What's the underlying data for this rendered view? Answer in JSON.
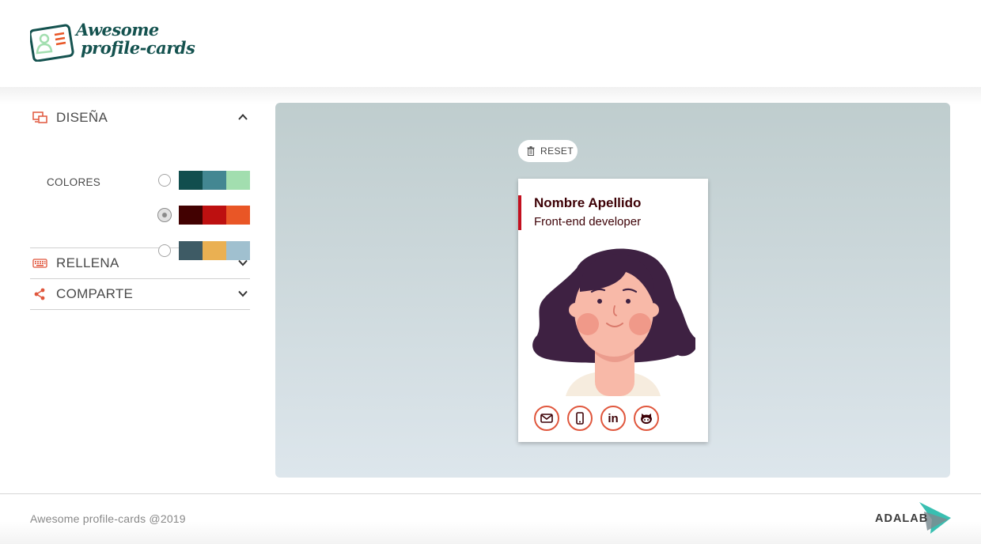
{
  "app": {
    "logo_line1": "Awesome",
    "logo_line2": "profile-cards"
  },
  "sidebar": {
    "design": {
      "label": "DISEÑA",
      "icon": "design-icon",
      "expanded": true
    },
    "colors_label": "COLORES",
    "palettes": [
      {
        "colors": [
          "#114e4e",
          "#438792",
          "#a2deaf"
        ],
        "selected": false
      },
      {
        "colors": [
          "#420101",
          "#bd1010",
          "#e95626"
        ],
        "selected": true
      },
      {
        "colors": [
          "#3e5b65",
          "#eab052",
          "#a0c0cf"
        ],
        "selected": false
      }
    ],
    "fill": {
      "label": "RELLENA",
      "icon": "keyboard-icon",
      "expanded": false
    },
    "share": {
      "label": "COMPARTE",
      "icon": "share-icon",
      "expanded": false
    }
  },
  "preview": {
    "reset_label": "RESET",
    "card": {
      "name": "Nombre Apellido",
      "job": "Front-end developer",
      "accent": "#c3101f",
      "text_color": "#3d0106",
      "border_color": "#e0563c",
      "social": [
        {
          "icon": "email-icon"
        },
        {
          "icon": "phone-icon"
        },
        {
          "icon": "linkedin-icon",
          "glyph": "in"
        },
        {
          "icon": "github-icon"
        }
      ]
    }
  },
  "footer": {
    "copyright": "Awesome profile-cards @2019",
    "brand": "ADALAB"
  }
}
